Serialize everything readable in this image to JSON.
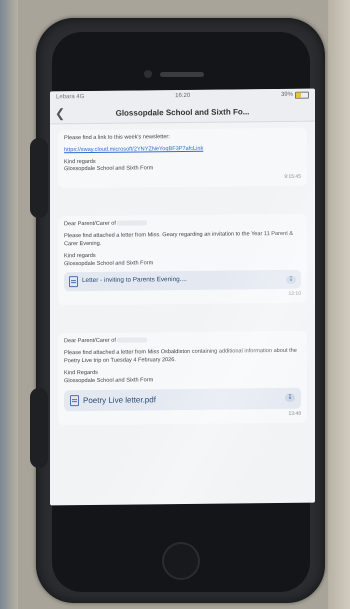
{
  "status_bar": {
    "carrier": "Lebara 4G",
    "time": "16:20",
    "battery": "39%",
    "battery_level": 0.39
  },
  "header": {
    "title": "Glossopdale School and Sixth Fo..."
  },
  "messages": [
    {
      "intro": "Please find a link to this week's newsletter:",
      "link": "https://sway.cloud.microsoft/2YNYZNeYoqBF3P7afcLink",
      "closing": "Kind regards",
      "sender": "Glossopdale School and Sixth Form",
      "time": "9:15:45"
    },
    {
      "greeting": "Dear Parent/Carer of",
      "body": "Please find attached a letter from Miss. Geary regarding an invitation to the Year 11 Parent & Carer Evening.",
      "closing": "Kind regards",
      "sender": "Glossopdale School and Sixth Form",
      "attachment": "Letter  - inviting to Parents Evening....",
      "time": "12:10"
    },
    {
      "greeting": "Dear Parent/Carer of",
      "body": "Please find attached a letter from Miss Osbaldiston containing additional information about the Poetry Live trip on Tuesday 4 February 2026.",
      "closing": "Kind Regards",
      "sender": "Glossopdale School and Sixth Form",
      "attachment": "Poetry Live letter.pdf",
      "time": "13:48"
    }
  ],
  "icons": {
    "back": "chevron-left-icon",
    "document": "document-icon",
    "download": "cloud-download-icon"
  },
  "colors": {
    "link": "#2f6bd1",
    "attachment_bg": "#e4e9f1",
    "battery": "#e3c43a"
  }
}
